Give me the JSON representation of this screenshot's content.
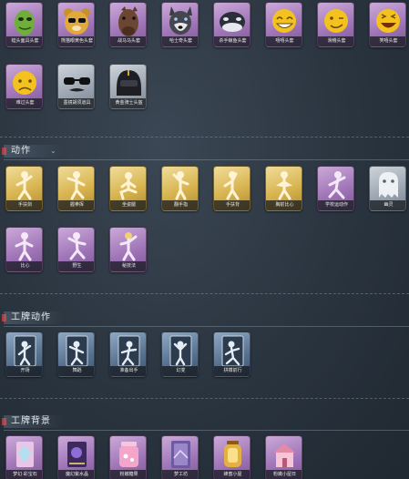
{
  "sections": {
    "emotes": {
      "title": "动作"
    },
    "card_emotes": {
      "title": "工牌动作"
    },
    "card_backgrounds": {
      "title": "工牌背景"
    }
  },
  "masks_row1": [
    {
      "caption": "蛙头面具头套",
      "color": "purple",
      "icon": "frog-mask-icon"
    },
    {
      "caption": "熊猫眼黄色头套",
      "color": "purple",
      "icon": "bear-mask-icon"
    },
    {
      "caption": "战马马头套",
      "color": "purple",
      "icon": "horse-mask-icon"
    },
    {
      "caption": "哈士奇头套",
      "color": "purple",
      "icon": "husky-mask-icon"
    },
    {
      "caption": "杀手鲸鱼头套",
      "color": "purple",
      "icon": "whale-mask-icon"
    },
    {
      "caption": "嘻嘻头套",
      "color": "purple",
      "icon": "grin-emoji-mask-icon"
    },
    {
      "caption": "滑稽头套",
      "color": "purple",
      "icon": "wink-emoji-mask-icon"
    },
    {
      "caption": "笑嘻头套",
      "color": "purple",
      "icon": "laugh-emoji-mask-icon"
    }
  ],
  "masks_row2": [
    {
      "caption": "难过头套",
      "color": "purple",
      "icon": "sad-emoji-mask-icon"
    },
    {
      "caption": "墨镜胡须道具",
      "color": "grey",
      "icon": "sunglasses-mustache-icon"
    },
    {
      "caption": "黄金骑士头盔",
      "color": "grey",
      "icon": "helmet-icon"
    }
  ],
  "emotes_row1": [
    {
      "caption": "手扶剑",
      "color": "gold",
      "icon": "pose-icon"
    },
    {
      "caption": "握拳挥",
      "color": "gold",
      "icon": "pose-icon"
    },
    {
      "caption": "坐姿腿",
      "color": "gold",
      "icon": "pose-icon"
    },
    {
      "caption": "翻手指",
      "color": "gold",
      "icon": "pose-icon"
    },
    {
      "caption": "手扶背",
      "color": "gold",
      "icon": "pose-icon"
    },
    {
      "caption": "胸前比心",
      "color": "gold",
      "icon": "pose-icon"
    },
    {
      "caption": "学校运动作",
      "color": "purple",
      "icon": "pose-icon"
    },
    {
      "caption": "幽灵",
      "color": "grey",
      "icon": "ghost-icon"
    }
  ],
  "emotes_row2": [
    {
      "caption": "比心",
      "color": "purple",
      "icon": "pose-icon"
    },
    {
      "caption": "野生",
      "color": "purple",
      "icon": "pose-icon"
    },
    {
      "caption": "秘技法",
      "color": "purple",
      "icon": "pose-icon"
    }
  ],
  "card_emotes_row": [
    {
      "caption": "开场",
      "color": "blue",
      "icon": "card-pose-icon"
    },
    {
      "caption": "舞蹈",
      "color": "blue",
      "icon": "card-pose-icon"
    },
    {
      "caption": "准备出手",
      "color": "blue",
      "icon": "card-pose-icon"
    },
    {
      "caption": "幻变",
      "color": "blue",
      "icon": "card-pose-icon"
    },
    {
      "caption": "拼搏前行",
      "color": "blue",
      "icon": "card-pose-icon"
    }
  ],
  "card_bg_row": [
    {
      "caption": "梦幻·彩宝石",
      "color": "purple",
      "icon": "crystal-icon"
    },
    {
      "caption": "魔幻紫水晶",
      "color": "purple",
      "icon": "book-icon"
    },
    {
      "caption": "粉嫩糖果",
      "color": "purple",
      "icon": "jar-icon"
    },
    {
      "caption": "梦工坊",
      "color": "purple",
      "icon": "card-icon"
    },
    {
      "caption": "蜂蜜小屋",
      "color": "purple",
      "icon": "lantern-icon"
    },
    {
      "caption": "粉嫩小屋日",
      "color": "purple",
      "icon": "house-icon"
    }
  ]
}
